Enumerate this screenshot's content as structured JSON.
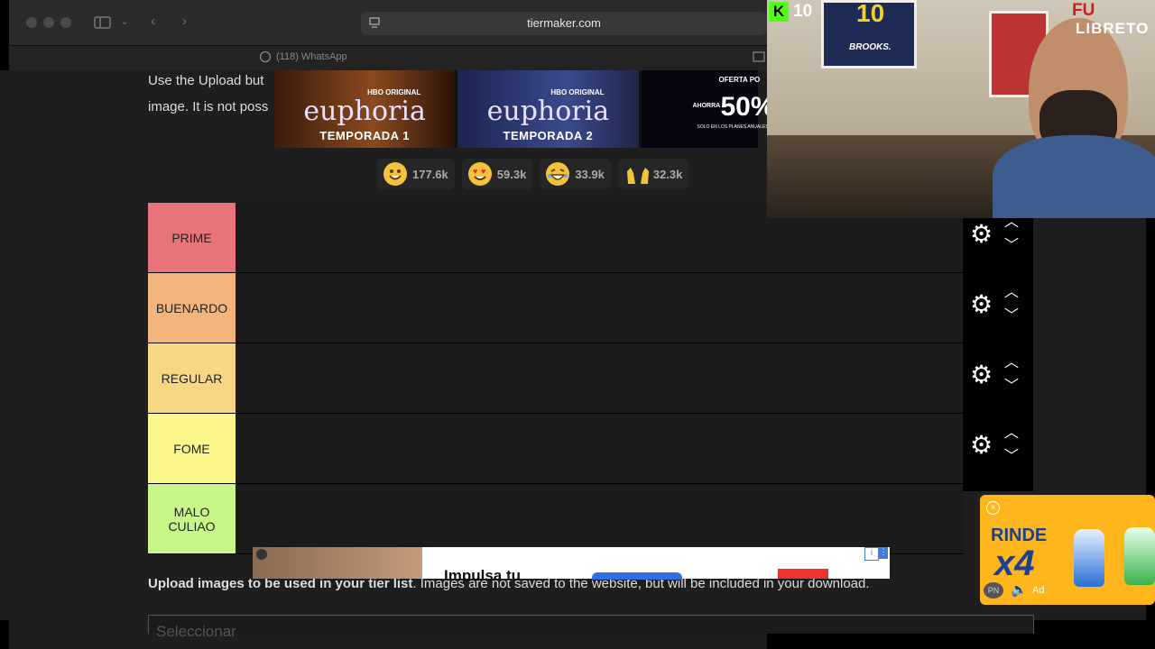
{
  "browser": {
    "url": "tiermaker.com",
    "tab_label": "(118) WhatsApp"
  },
  "page": {
    "intro_line1": "Use the Upload but",
    "intro_line2": "image. It is not poss",
    "upload_note_bold": "Upload images to be used in your tier list",
    "upload_note_rest": ". Images are not saved to the website, but will be included in your download.",
    "select_button": "Seleccionar"
  },
  "ad_banner": {
    "panels": [
      {
        "brand": "euphoria",
        "network": "HBO ORIGINAL",
        "season": "TEMPORADA 1"
      },
      {
        "brand": "euphoria",
        "network": "HBO ORIGINAL",
        "season": "TEMPORADA 2"
      }
    ],
    "offer": {
      "header": "OFERTA PO",
      "prefix": "AHORRA",
      "value": "50%",
      "footer": "SOLO EN LOS PLANES ANUALES"
    }
  },
  "reactions": [
    {
      "icon": "smile-emoji-icon",
      "count": "177.6k"
    },
    {
      "icon": "heart-eyes-emoji-icon",
      "count": "59.3k"
    },
    {
      "icon": "laughing-emoji-icon",
      "count": "33.9k"
    },
    {
      "icon": "raised-hands-emoji-icon",
      "count": "32.3k"
    }
  ],
  "tiers": [
    {
      "label": "PRIME",
      "color": "#e8737b"
    },
    {
      "label": "BUENARDO",
      "color": "#f4b57d"
    },
    {
      "label": "REGULAR",
      "color": "#f7d684"
    },
    {
      "label": "FOME",
      "color": "#fbf78a"
    },
    {
      "label": "MALO CULIAO",
      "color": "#c8f787"
    }
  ],
  "stream": {
    "kick_count": "10",
    "jersey_number": "10",
    "jersey_sponsor": "BROOKS.",
    "logo_top": "FU",
    "logo_bottom": "LIBRETO"
  },
  "side_ad": {
    "line1": "RINDE",
    "line2": "x4",
    "badge": "PN",
    "ad_label": "Ad"
  },
  "bottom_ad": {
    "text": "Impulsa tu"
  }
}
